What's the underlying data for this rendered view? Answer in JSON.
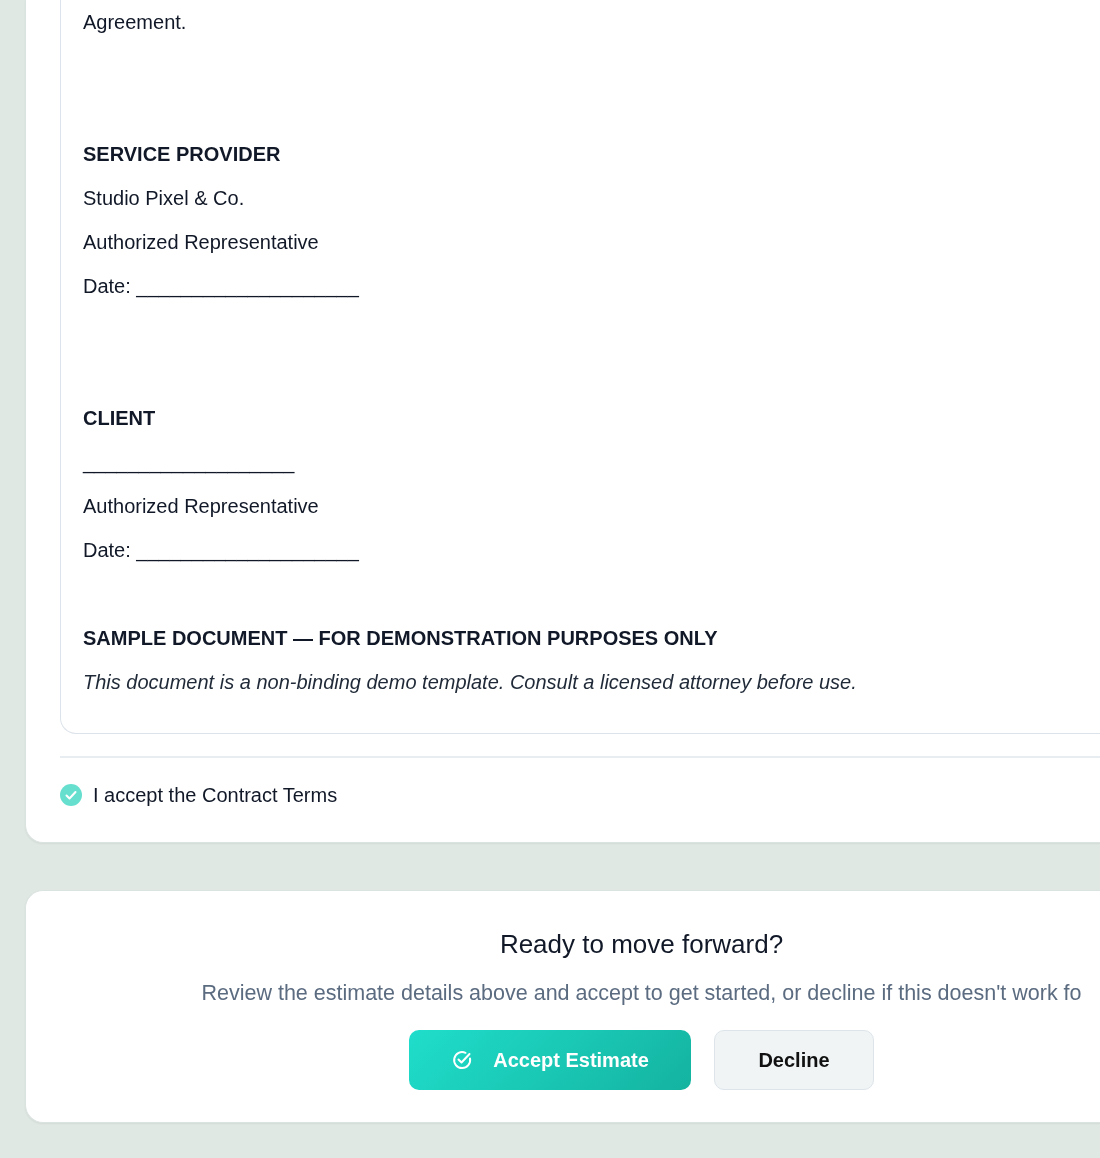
{
  "contract": {
    "document": [
      {
        "kind": "paragraph",
        "text": "Agreement."
      },
      {
        "kind": "section",
        "heading": "SERVICE PROVIDER",
        "lines": [
          "Studio Pixel & Co.",
          "Authorized Representative",
          "Date: ____________________"
        ]
      },
      {
        "kind": "section",
        "heading": "CLIENT",
        "lines": [
          "___________________",
          "Authorized Representative",
          "Date: ____________________"
        ]
      },
      {
        "kind": "notice",
        "heading": "SAMPLE DOCUMENT — FOR DEMONSTRATION PURPOSES ONLY",
        "text": "This document is a non-binding demo template. Consult a licensed attorney before use."
      }
    ],
    "accept_terms": {
      "label": "I accept the Contract Terms",
      "checked": true
    }
  },
  "cta": {
    "title": "Ready to move forward?",
    "text": "Review the estimate details above and accept to get started, or decline if this doesn't work fo",
    "buttons": [
      {
        "label": "Accept Estimate",
        "kind": "primary"
      },
      {
        "label": "Decline",
        "kind": "secondary"
      }
    ]
  }
}
